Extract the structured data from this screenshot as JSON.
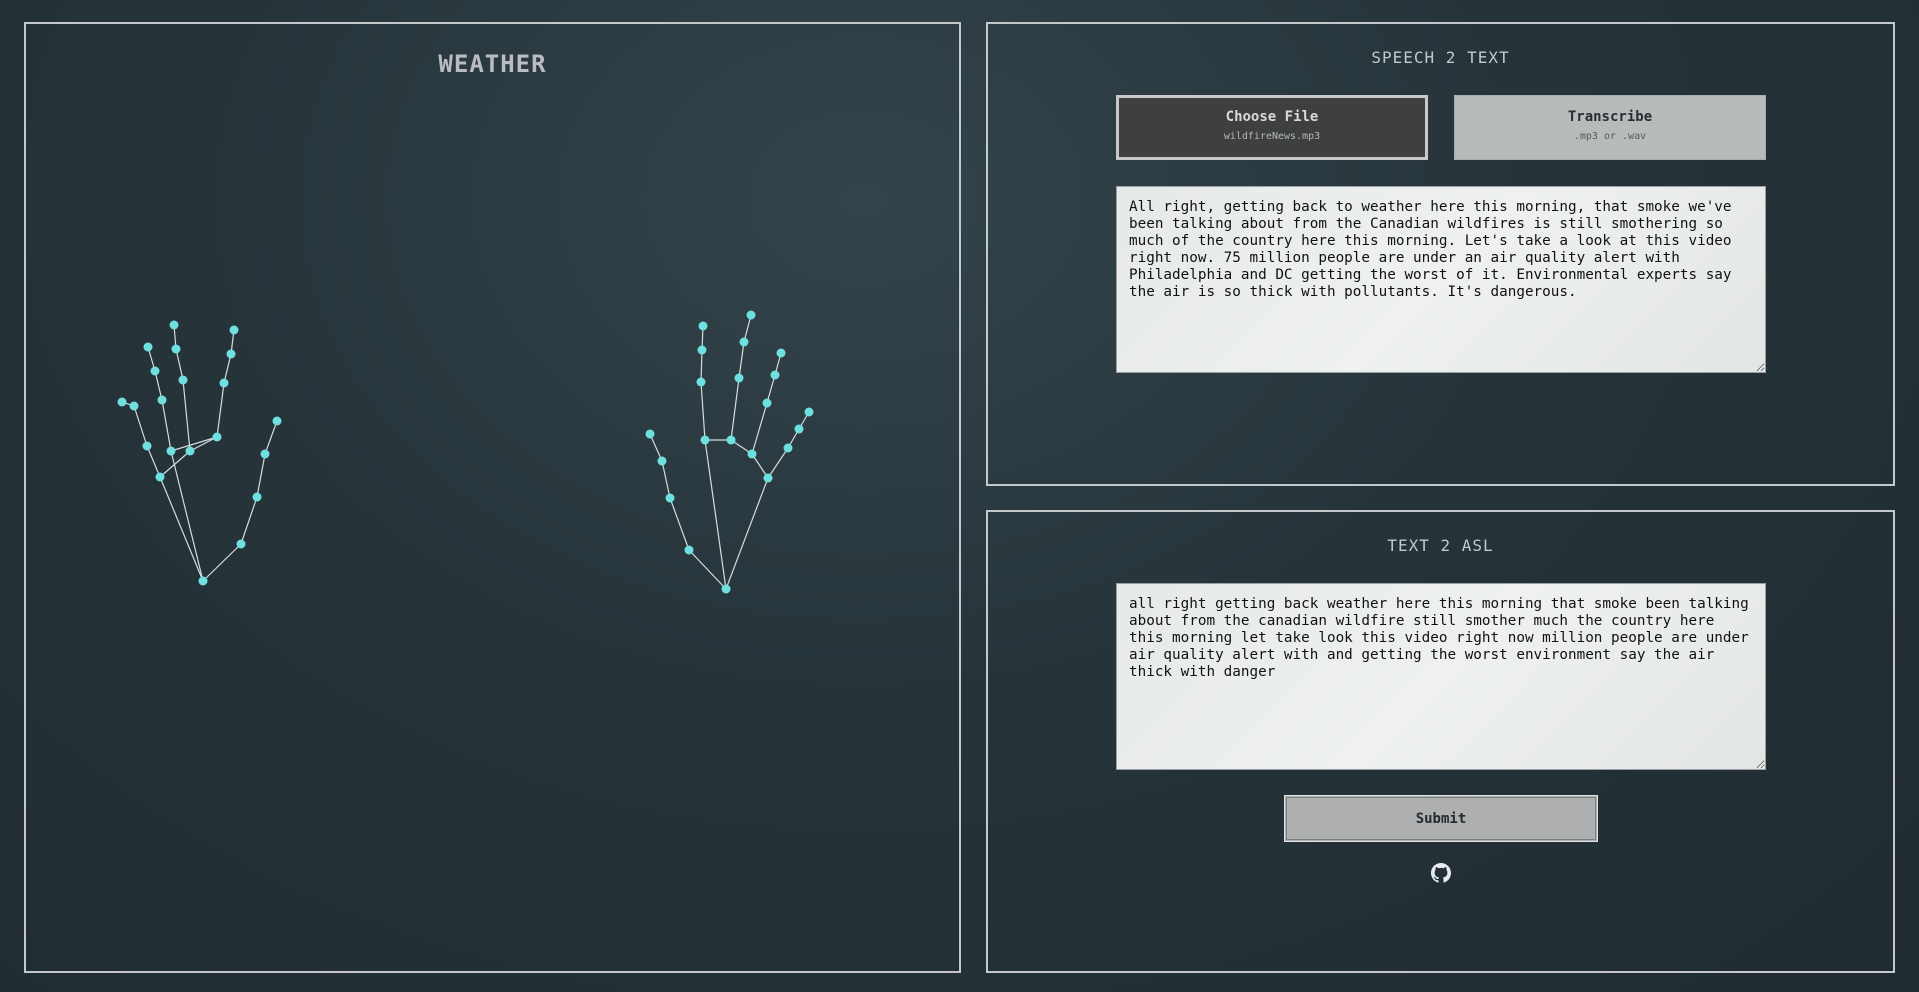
{
  "left_panel": {
    "title": "WEATHER"
  },
  "speech_panel": {
    "title": "SPEECH 2 TEXT",
    "choose_file": {
      "label": "Choose File",
      "filename": "wildfireNews.mp3"
    },
    "transcribe": {
      "label": "Transcribe",
      "hint": ".mp3 or .wav"
    },
    "transcript": "All right, getting back to weather here this morning, that smoke we've been talking about from the Canadian wildfires is still smothering so much of the country here this morning. Let's take a look at this video right now. 75 million people are under an air quality alert with Philadelphia and DC getting the worst of it. Environmental experts say the air is so thick with pollutants. It's dangerous."
  },
  "asl_panel": {
    "title": "TEXT 2 ASL",
    "asl_text": "all right getting back weather here this morning that smoke been talking about from the canadian wildfire still smother much the country here this morning let take look this video right now million people are under air quality alert with and getting the worst environment say the air thick with danger",
    "submit_label": "Submit",
    "github_icon": "github-icon"
  },
  "colors": {
    "landmark": "#6fe0e0",
    "skeleton": "#d6dcdd",
    "panel_border": "#c4c8ca"
  }
}
